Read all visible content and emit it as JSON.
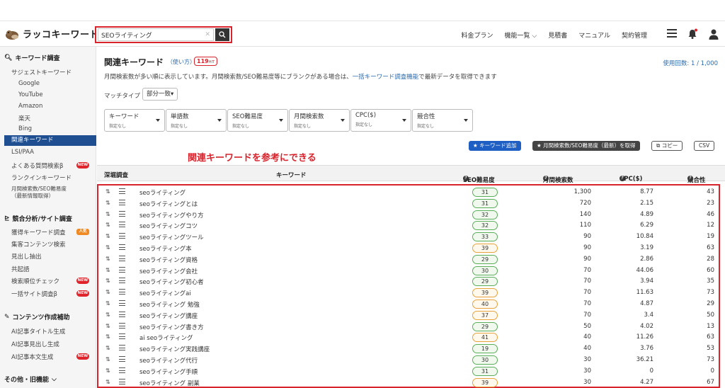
{
  "header": {
    "logo_text": "ラッコキーワード",
    "search_value": "SEOライティング",
    "nav": [
      "料金プラン",
      "機能一覧",
      "見積書",
      "マニュアル",
      "契約管理"
    ]
  },
  "sidebar": {
    "section1_title": "キーワード調査",
    "suggest": "サジェストキーワード",
    "sub": [
      "Google",
      "YouTube",
      "Amazon",
      "楽天",
      "Bing"
    ],
    "active": "関連キーワード",
    "lsi": "LSI/PAA",
    "faq": "よくある質問検索β",
    "rankin": "ランクインキーワード",
    "monthly1": "月間検索数/SEO難易度",
    "monthly2": "（最新情報取得）",
    "section2_title": "競合分析/サイト調査",
    "acq": "獲得キーワード調査",
    "collect": "集客コンテンツ検索",
    "headings": "見出し抽出",
    "cooccur": "共起語",
    "rankcheck": "検索順位チェック",
    "bulk": "一括サイト調査β",
    "section3_title": "コンテンツ作成補助",
    "ai_title": "AI記事タイトル生成",
    "ai_heading": "AI記事見出し生成",
    "ai_body": "AI記事本文生成",
    "section4_title": "その他・旧機能",
    "badge_new": "NEW",
    "badge_pop": "人気"
  },
  "main": {
    "title": "関連キーワード",
    "howto": "（使い方）",
    "hit_count": "119",
    "hit_unit": "HIT",
    "usage": "使用回数: 1 / 1,000",
    "desc_before": "月間検索数が多い順に表示しています。月間検索数/SEO難易度等にブランクがある場合は、",
    "desc_link": "一括キーワード調査機能",
    "desc_after": "で最新データを取得できます",
    "match_label": "マッチタイプ",
    "match_value": "部分一致▾",
    "filters": [
      {
        "label": "キーワード",
        "value": "指定なし"
      },
      {
        "label": "単語数",
        "value": "指定なし"
      },
      {
        "label": "SEO難易度",
        "value": "指定なし"
      },
      {
        "label": "月間検索数",
        "value": "指定なし"
      },
      {
        "label": "CPC($)",
        "value": "指定なし"
      },
      {
        "label": "競合性",
        "value": "指定なし"
      }
    ],
    "btn_add": "★ キーワード追加",
    "btn_fetch": "★ 月間検索数/SEO難易度（最新）を取得",
    "btn_copy": "コピー",
    "btn_csv": "CSV",
    "annotation": "関連キーワードを参考にできる"
  },
  "table": {
    "columns": [
      "深堀調査",
      "キーワード",
      "SEO難易度",
      "月間検索数",
      "CPC($)",
      "競合性"
    ],
    "rows": [
      {
        "kw": "seoライティング",
        "seo": 31,
        "tone": "g",
        "vol": "1,300",
        "cpc": "8.77",
        "comp": "43"
      },
      {
        "kw": "seoライティングとは",
        "seo": 31,
        "tone": "g",
        "vol": "720",
        "cpc": "2.15",
        "comp": "23"
      },
      {
        "kw": "seoライティングやり方",
        "seo": 32,
        "tone": "g",
        "vol": "140",
        "cpc": "4.89",
        "comp": "46"
      },
      {
        "kw": "seoライティングコツ",
        "seo": 32,
        "tone": "g",
        "vol": "110",
        "cpc": "6.29",
        "comp": "12"
      },
      {
        "kw": "seoライティングツール",
        "seo": 33,
        "tone": "g",
        "vol": "90",
        "cpc": "10.84",
        "comp": "19"
      },
      {
        "kw": "seoライティング本",
        "seo": 39,
        "tone": "o",
        "vol": "90",
        "cpc": "3.19",
        "comp": "63"
      },
      {
        "kw": "seoライティング資格",
        "seo": 29,
        "tone": "g",
        "vol": "90",
        "cpc": "2.86",
        "comp": "28"
      },
      {
        "kw": "seoライティング会社",
        "seo": 30,
        "tone": "g",
        "vol": "70",
        "cpc": "44.06",
        "comp": "60"
      },
      {
        "kw": "seoライティング初心者",
        "seo": 29,
        "tone": "g",
        "vol": "70",
        "cpc": "3.94",
        "comp": "35"
      },
      {
        "kw": "seoライティングai",
        "seo": 39,
        "tone": "o",
        "vol": "70",
        "cpc": "11.63",
        "comp": "73"
      },
      {
        "kw": "seoライティング 勉強",
        "seo": 40,
        "tone": "o",
        "vol": "70",
        "cpc": "4.87",
        "comp": "29"
      },
      {
        "kw": "seoライティング講座",
        "seo": 37,
        "tone": "o",
        "vol": "70",
        "cpc": "3.4",
        "comp": "50"
      },
      {
        "kw": "seoライティング書き方",
        "seo": 29,
        "tone": "g",
        "vol": "50",
        "cpc": "4.02",
        "comp": "13"
      },
      {
        "kw": "ai seoライティング",
        "seo": 41,
        "tone": "o",
        "vol": "40",
        "cpc": "11.26",
        "comp": "63"
      },
      {
        "kw": "seoライティング実践講座",
        "seo": 19,
        "tone": "g",
        "vol": "40",
        "cpc": "3.76",
        "comp": "53"
      },
      {
        "kw": "seoライティング代行",
        "seo": 30,
        "tone": "g",
        "vol": "30",
        "cpc": "36.21",
        "comp": "73"
      },
      {
        "kw": "seoライティング手順",
        "seo": 31,
        "tone": "g",
        "vol": "30",
        "cpc": "0",
        "comp": "0"
      },
      {
        "kw": "seoライティング 副業",
        "seo": 39,
        "tone": "o",
        "vol": "30",
        "cpc": "4.27",
        "comp": "67"
      }
    ]
  },
  "colors": {
    "accent": "#1f4f91",
    "highlight": "#d9232d",
    "link": "#2b6cb0"
  }
}
